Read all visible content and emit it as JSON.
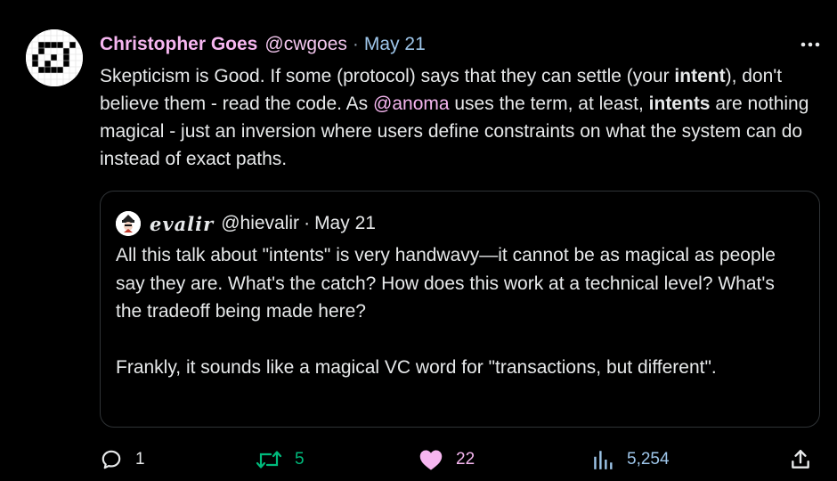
{
  "tweet": {
    "author_name": "Christopher Goes",
    "handle": "@cwgoes",
    "separator": "·",
    "date": "May 21",
    "text_parts": [
      "Skepticism is Good. If some (protocol) says that they can settle (your ",
      "intent",
      "), don't believe them - read the code. As ",
      "@anoma",
      " uses the term, at least, ",
      "intents",
      " are nothing magical - just an inversion where users define constraints on what the system can do instead of exact paths."
    ]
  },
  "quoted": {
    "author_name": "evalir",
    "handle": "@hievalir",
    "separator": "·",
    "date": "May 21",
    "paragraph1": "All this talk about \"intents\" is very handwavy—it cannot be as magical as people say they are. What's the catch? How does this work at a technical level? What's the tradeoff being made here?",
    "paragraph2": "Frankly, it sounds like a magical VC word for \"transactions, but different\"."
  },
  "actions": {
    "reply_count": "1",
    "retweet_count": "5",
    "like_count": "22",
    "view_count": "5,254"
  },
  "icons": {
    "more": "more-dots-icon",
    "reply": "reply-icon",
    "retweet": "retweet-icon",
    "like": "heart-icon",
    "views": "views-icon",
    "share": "share-icon"
  },
  "colors": {
    "background": "#000000",
    "text": "#e7e9ea",
    "accent_pink": "#f6b6f0",
    "retweet_green": "#00ba7c",
    "views_blue": "#9ec6ea",
    "border": "#2f3336"
  }
}
